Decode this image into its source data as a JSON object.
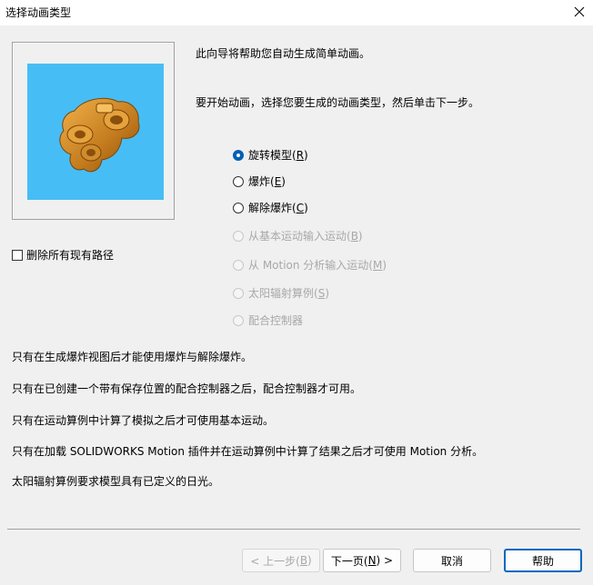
{
  "window": {
    "title": "选择动画类型"
  },
  "intro": "此向导将帮助您自动生成简单动画。",
  "start": "要开始动画，选择您要生成的动画类型，然后单击下一步。",
  "options": [
    {
      "label": "旋转模型(",
      "key": "R",
      "tail": ")"
    },
    {
      "label": "爆炸(",
      "key": "E",
      "tail": ")"
    },
    {
      "label": "解除爆炸(",
      "key": "C",
      "tail": ")"
    },
    {
      "label": "从基本运动输入运动(",
      "key": "B",
      "tail": ")"
    },
    {
      "label": "从 Motion 分析输入运动(",
      "key": "M",
      "tail": ")"
    },
    {
      "label": "太阳辐射算例(",
      "key": "S",
      "tail": ")"
    },
    {
      "label": "配合控制器",
      "key": "",
      "tail": ""
    }
  ],
  "delete_paths": "删除所有现有路径",
  "notes": [
    "只有在生成爆炸视图后才能使用爆炸与解除爆炸。",
    "只有在已创建一个带有保存位置的配合控制器之后，配合控制器才可用。",
    "只有在运动算例中计算了模拟之后才可使用基本运动。",
    "只有在加载 SOLIDWORKS Motion 插件并在运动算例中计算了结果之后才可使用 Motion 分析。",
    "太阳辐射算例要求模型具有已定义的日光。"
  ],
  "buttons": {
    "back_label": "< 上一步(",
    "back_key": "B",
    "back_tail": ")",
    "next_label": "下一页(",
    "next_key": "N",
    "next_tail": ") >",
    "cancel": "取消",
    "help": "帮助"
  }
}
